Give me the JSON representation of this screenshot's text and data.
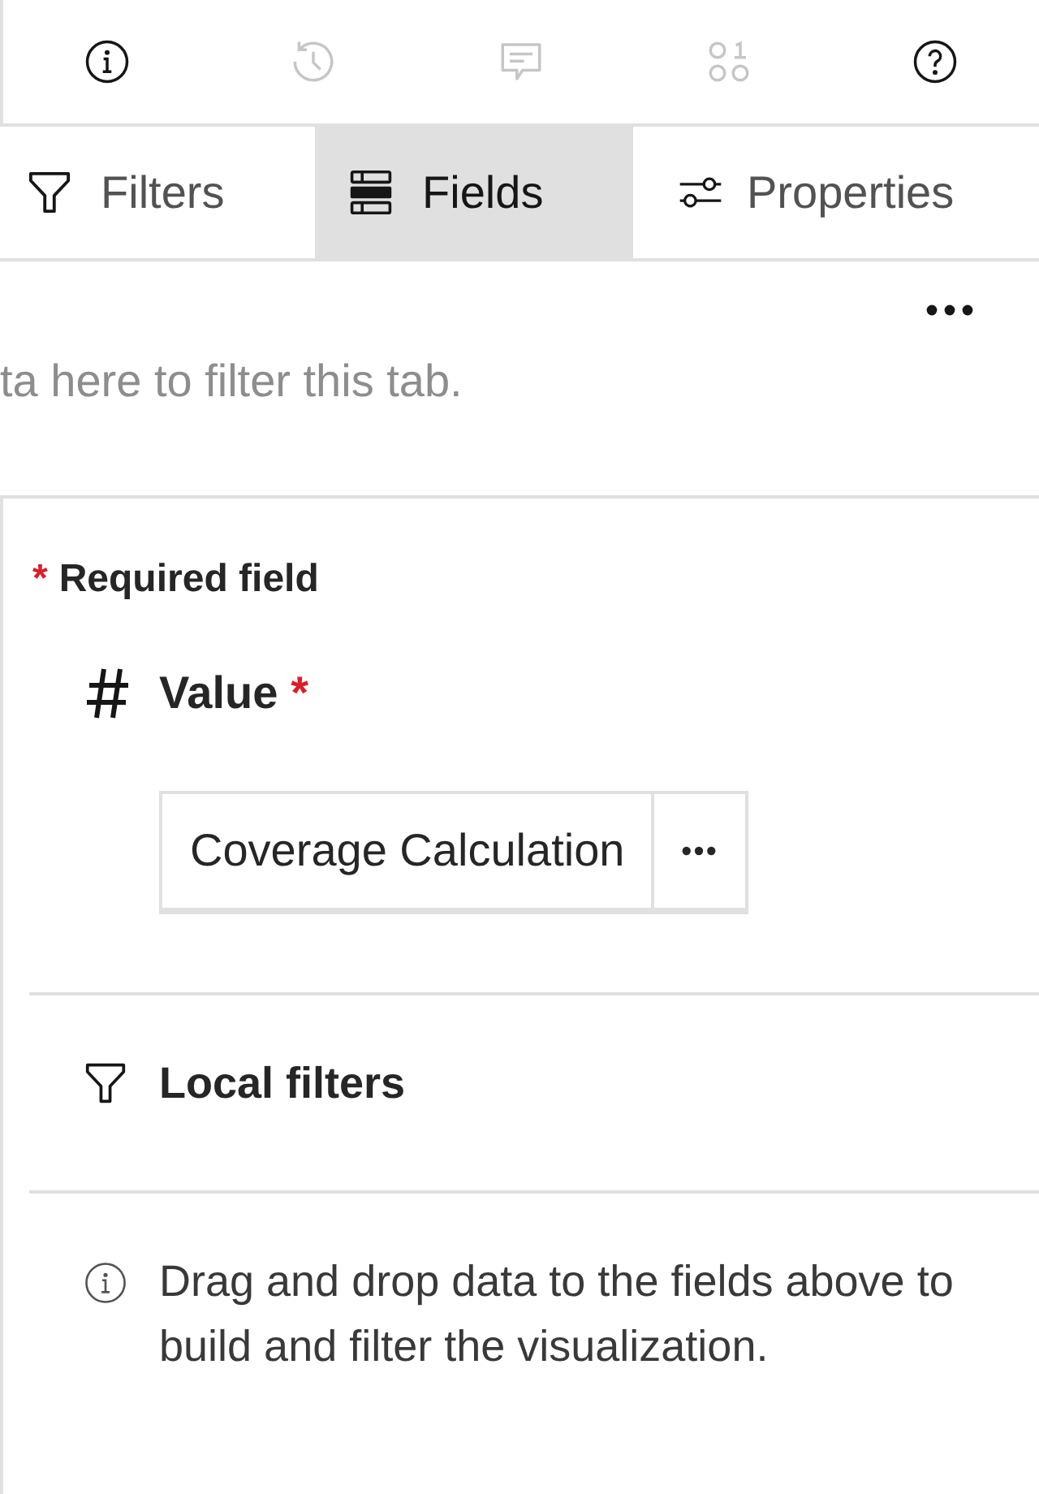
{
  "toolbar": {
    "buttons": [
      {
        "kind": "info",
        "disabled": false
      },
      {
        "kind": "history",
        "disabled": true
      },
      {
        "kind": "comment",
        "disabled": true
      },
      {
        "kind": "data",
        "disabled": true
      },
      {
        "kind": "help",
        "disabled": false
      }
    ]
  },
  "tabs": [
    {
      "kind": "filter",
      "label": "Filters",
      "selected": false
    },
    {
      "kind": "fields",
      "label": "Fields",
      "selected": true
    },
    {
      "kind": "properties",
      "label": "Properties",
      "selected": false
    }
  ],
  "filter_area": {
    "hint": "ta here to filter this tab."
  },
  "fields_panel": {
    "required_note": {
      "mark": "*",
      "text": "Required field"
    },
    "slots": [
      {
        "kind": "measure",
        "label": "Value",
        "required_mark": "*",
        "items": [
          {
            "label": "Coverage Calculation"
          }
        ]
      },
      {
        "kind": "filter",
        "label": "Local filters"
      }
    ],
    "info": {
      "text": "Drag and drop data to the fields above to build and filter the visualization."
    }
  }
}
